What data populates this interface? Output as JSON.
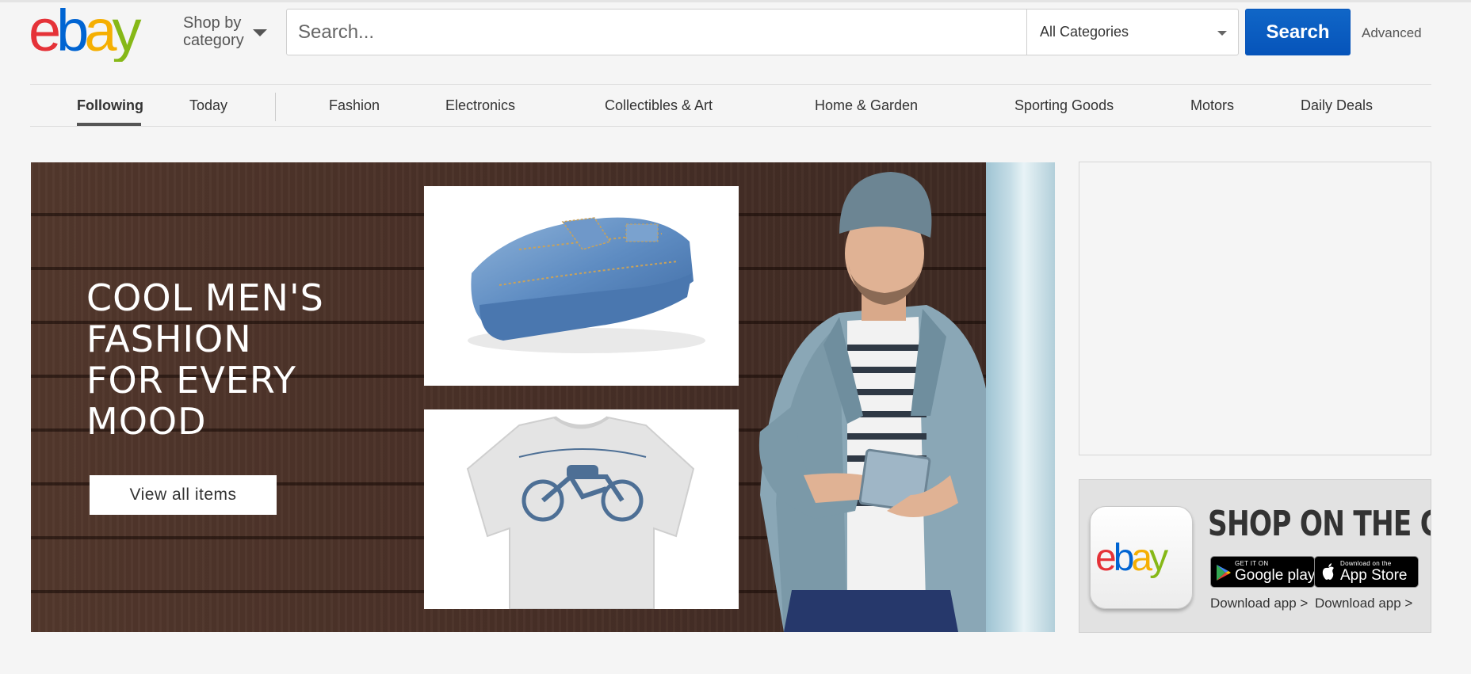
{
  "header": {
    "logo_text": "ebay",
    "shop_by_line1": "Shop by",
    "shop_by_line2": "category",
    "search_placeholder": "Search...",
    "category_selected": "All Categories",
    "search_button": "Search",
    "advanced_link": "Advanced"
  },
  "nav": {
    "items": [
      {
        "label": "Following",
        "active": true
      },
      {
        "label": "Today"
      },
      {
        "label": "Fashion"
      },
      {
        "label": "Electronics"
      },
      {
        "label": "Collectibles & Art"
      },
      {
        "label": "Home & Garden"
      },
      {
        "label": "Sporting Goods"
      },
      {
        "label": "Motors"
      },
      {
        "label": "Daily Deals"
      }
    ]
  },
  "hero": {
    "title_lines": [
      "COOL MEN'S",
      "FASHION",
      "FOR EVERY",
      "MOOD"
    ],
    "cta": "View all items"
  },
  "app_promo": {
    "icon_text": "ebay",
    "headline": "SHOP ON THE GO",
    "google_small": "GET IT ON",
    "google_big": "Google play",
    "apple_small": "Download on the",
    "apple_big": "App Store",
    "download_1": "Download app >",
    "download_2": "Download app >"
  },
  "colors": {
    "ebay_red": "#e53238",
    "ebay_blue": "#0064d2",
    "ebay_yellow": "#f5af02",
    "ebay_green": "#86b817",
    "search_button": "#0654ba"
  }
}
